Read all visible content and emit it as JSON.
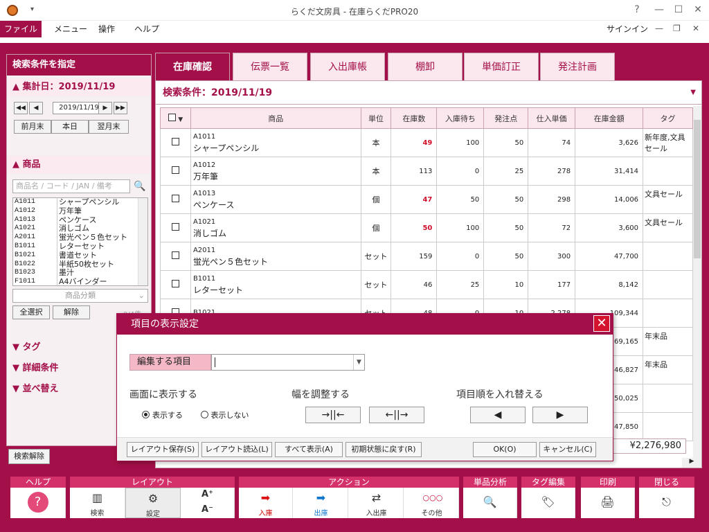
{
  "window": {
    "title": "らくだ文房具 - 在庫らくだPRO20",
    "controls": [
      "?",
      "—",
      "☐",
      "✕"
    ]
  },
  "menu": {
    "items": [
      "ファイル",
      "メニュー",
      "操作",
      "ヘルプ"
    ],
    "signin": "サインイン"
  },
  "left_panel": {
    "title": "検索条件を指定",
    "date_section": "集計日：2019/11/19",
    "date_value": "2019/11/19",
    "date_buttons": [
      "前月末",
      "本日",
      "翌月末"
    ],
    "product_section": "商品",
    "search_placeholder": "商品名 / コード / JAN / 備考",
    "products": [
      {
        "code": "A1011",
        "name": "シャープペンシル"
      },
      {
        "code": "A1012",
        "name": "万年筆"
      },
      {
        "code": "A1013",
        "name": "ペンケース"
      },
      {
        "code": "A1021",
        "name": "消しゴム"
      },
      {
        "code": "A2011",
        "name": "蛍光ペン５色セット"
      },
      {
        "code": "B1011",
        "name": "レターセット"
      },
      {
        "code": "B1021",
        "name": "書道セット"
      },
      {
        "code": "B1022",
        "name": "半紙50枚セット"
      },
      {
        "code": "B1023",
        "name": "墨汁"
      },
      {
        "code": "F1011",
        "name": "A4バインダー"
      }
    ],
    "category_placeholder": "商品分類",
    "select_all": "全選択",
    "deselect": "解除",
    "count_label": "0/4件",
    "tag_section": "タグ",
    "detail_section": "詳細条件",
    "sort_section": "並べ替え",
    "clear_search": "検索解除"
  },
  "tabs": [
    "在庫確認",
    "伝票一覧",
    "入出庫帳",
    "棚卸",
    "単価訂正",
    "発注計画"
  ],
  "active_tab": 0,
  "main": {
    "condition": "検索条件：2019/11/19",
    "columns": [
      "商品",
      "単位",
      "在庫数",
      "入庫待ち",
      "発注点",
      "仕入単価",
      "在庫金額",
      "タグ"
    ],
    "rows": [
      {
        "code": "A1011",
        "name": "シャープペンシル",
        "unit": "本",
        "stock": "49",
        "stock_low": true,
        "incoming": "100",
        "reorder": "50",
        "price": "74",
        "amount": "3,626",
        "tag": "新年度,文具セール"
      },
      {
        "code": "A1012",
        "name": "万年筆",
        "unit": "本",
        "stock": "113",
        "stock_low": false,
        "incoming": "0",
        "reorder": "25",
        "price": "278",
        "amount": "31,414",
        "tag": ""
      },
      {
        "code": "A1013",
        "name": "ペンケース",
        "unit": "個",
        "stock": "47",
        "stock_low": true,
        "incoming": "50",
        "reorder": "50",
        "price": "298",
        "amount": "14,006",
        "tag": "文具セール"
      },
      {
        "code": "A1021",
        "name": "消しゴム",
        "unit": "個",
        "stock": "50",
        "stock_low": true,
        "incoming": "100",
        "reorder": "50",
        "price": "72",
        "amount": "3,600",
        "tag": "文具セール"
      },
      {
        "code": "A2011",
        "name": "蛍光ペン５色セット",
        "unit": "セット",
        "stock": "159",
        "stock_low": false,
        "incoming": "0",
        "reorder": "50",
        "price": "300",
        "amount": "47,700",
        "tag": ""
      },
      {
        "code": "B1011",
        "name": "レターセット",
        "unit": "セット",
        "stock": "46",
        "stock_low": false,
        "incoming": "25",
        "reorder": "10",
        "price": "177",
        "amount": "8,142",
        "tag": ""
      },
      {
        "code": "B1021",
        "name": "",
        "unit": "セット",
        "stock": "48",
        "stock_low": false,
        "incoming": "0",
        "reorder": "10",
        "price": "2,278",
        "amount": "109,344",
        "tag": ""
      },
      {
        "code": "",
        "name": "",
        "unit": "",
        "stock": "",
        "stock_low": false,
        "incoming": "",
        "reorder": "",
        "price": "",
        "amount": "69,165",
        "tag": "年末品"
      },
      {
        "code": "",
        "name": "",
        "unit": "",
        "stock": "",
        "stock_low": false,
        "incoming": "",
        "reorder": "",
        "price": "",
        "amount": "46,827",
        "tag": "年末品"
      },
      {
        "code": "",
        "name": "",
        "unit": "",
        "stock": "",
        "stock_low": false,
        "incoming": "",
        "reorder": "",
        "price": "",
        "amount": "50,025",
        "tag": ""
      },
      {
        "code": "",
        "name": "",
        "unit": "",
        "stock": "",
        "stock_low": false,
        "incoming": "",
        "reorder": "",
        "price": "",
        "amount": "47,850",
        "tag": ""
      }
    ],
    "total": "¥2,276,980"
  },
  "dialog": {
    "title": "項目の表示設定",
    "edit_label": "編集する項目",
    "edit_value": "",
    "show_section": "画面に表示する",
    "width_section": "幅を調整する",
    "order_section": "項目順を入れ替える",
    "radio_show": "表示する",
    "radio_hide": "表示しない",
    "show_selected": true,
    "narrow_btn": "→||←",
    "wide_btn": "←||→",
    "move_left_btn": "◀",
    "move_right_btn": "▶",
    "bottom_buttons": [
      "レイアウト保存(S)",
      "レイアウト読込(L)",
      "すべて表示(A)",
      "初期状態に戻す(R)"
    ],
    "ok": "OK(O)",
    "cancel": "キャンセル(C)"
  },
  "toolbar": {
    "groups": [
      {
        "head": "ヘルプ",
        "buttons": [
          {
            "label": "",
            "icon": "?"
          }
        ]
      },
      {
        "head": "レイアウト",
        "buttons": [
          {
            "label": "検索",
            "icon": "▥"
          },
          {
            "label": "設定",
            "icon": "⚙"
          },
          {
            "label": "",
            "icon": "A⁺"
          },
          {
            "label": "",
            "icon": "A⁻"
          }
        ]
      },
      {
        "head": "アクション",
        "buttons": [
          {
            "label": "入庫",
            "icon": "➡"
          },
          {
            "label": "出庫",
            "icon": "➡"
          },
          {
            "label": "入出庫",
            "icon": "⇄"
          },
          {
            "label": "その他",
            "icon": "○○○"
          }
        ]
      },
      {
        "head": "単品分析",
        "buttons": [
          {
            "label": "",
            "icon": "🔍"
          }
        ]
      },
      {
        "head": "タグ編集",
        "buttons": [
          {
            "label": "",
            "icon": "🏷"
          }
        ]
      },
      {
        "head": "印刷",
        "buttons": [
          {
            "label": "",
            "icon": "🖨"
          }
        ]
      },
      {
        "head": "閉じる",
        "buttons": [
          {
            "label": "",
            "icon": "⎋"
          }
        ]
      }
    ]
  },
  "colors": {
    "accent": "#a30f48",
    "accent_light": "#fbe7ee",
    "low_stock": "#d0102a"
  }
}
